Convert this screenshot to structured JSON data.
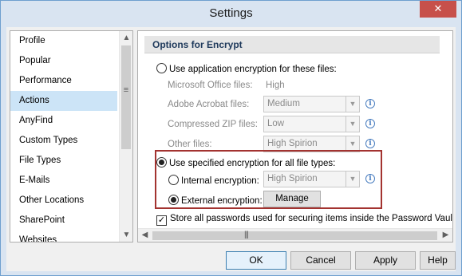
{
  "window": {
    "title": "Settings",
    "close_glyph": "✕"
  },
  "sidebar": {
    "items": [
      {
        "label": "Profile"
      },
      {
        "label": "Popular"
      },
      {
        "label": "Performance"
      },
      {
        "label": "Actions",
        "selected": true
      },
      {
        "label": "AnyFind"
      },
      {
        "label": "Custom Types"
      },
      {
        "label": "File Types"
      },
      {
        "label": "E-Mails"
      },
      {
        "label": "Other Locations"
      },
      {
        "label": "SharePoint"
      },
      {
        "label": "Websites"
      }
    ]
  },
  "panel": {
    "section_title": "Options for Encrypt",
    "app_encryption": {
      "label": "Use application encryption for these files:",
      "checked": false,
      "office_label": "Microsoft Office files:",
      "office_value": "High",
      "acrobat_label": "Adobe Acrobat files:",
      "acrobat_value": "Medium",
      "zip_label": "Compressed ZIP files:",
      "zip_value": "Low",
      "other_label": "Other files:",
      "other_value": "High Spirion"
    },
    "specified_encryption": {
      "label": "Use specified encryption for all file types:",
      "checked": true,
      "internal_label": "Internal encryption:",
      "internal_checked": false,
      "internal_value": "High Spirion",
      "external_label": "External encryption:",
      "external_checked": true,
      "manage_label": "Manage"
    },
    "store_passwords": {
      "label": "Store all passwords used for securing items inside the Password Vault",
      "checked": true
    },
    "info_glyph": "i",
    "highlight_color": "#a33330"
  },
  "footer": {
    "ok_label": "OK",
    "cancel_label": "Cancel",
    "apply_label": "Apply",
    "help_label": "Help"
  }
}
